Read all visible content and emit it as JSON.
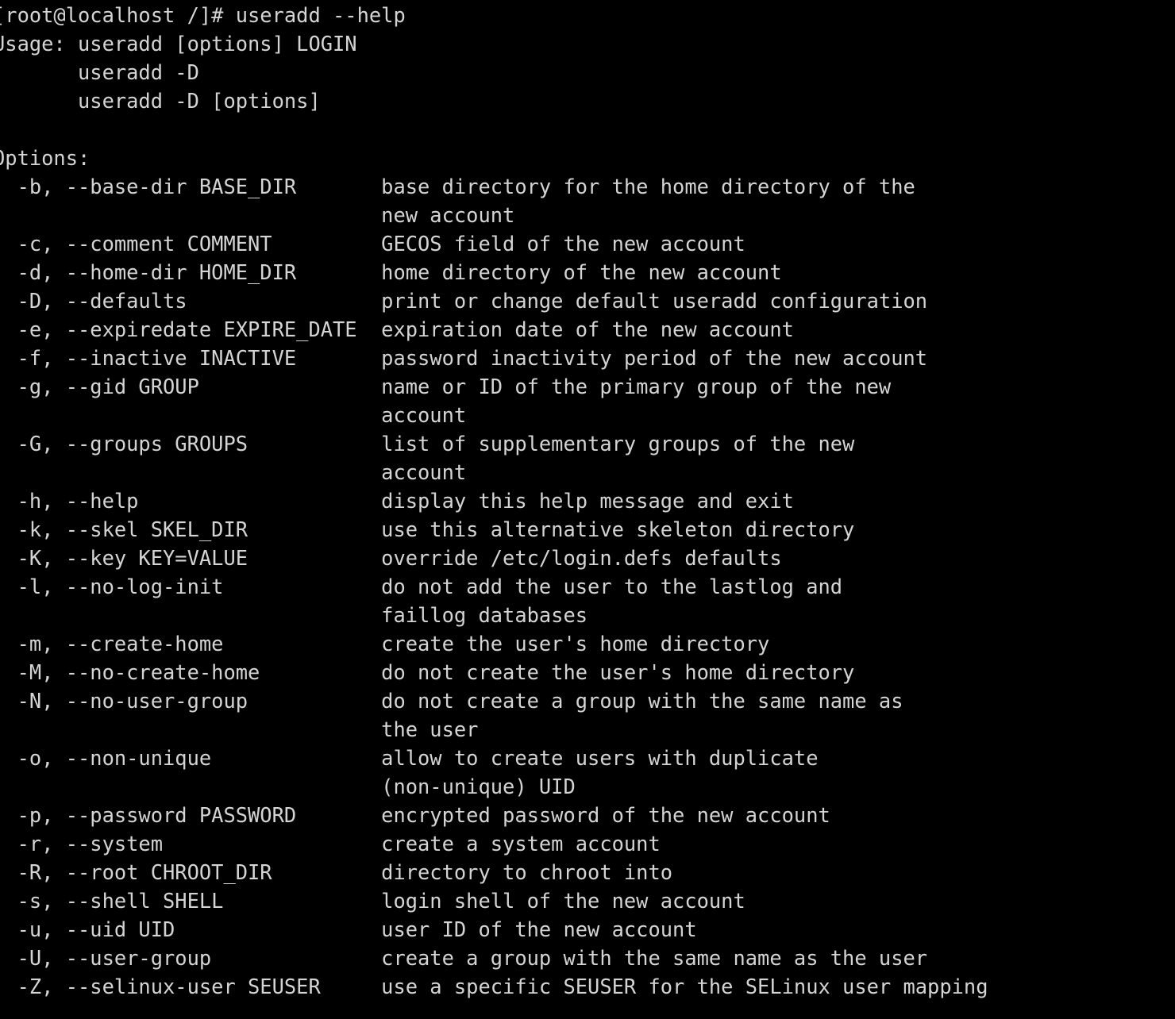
{
  "terminal": {
    "background_color": "#000000",
    "text_color": "#d4d4d4",
    "columns": 83,
    "rows": 36
  },
  "prompt": {
    "line": "[root@localhost /]# useradd --help",
    "user": "root",
    "host": "localhost",
    "cwd": "/",
    "symbol": "#",
    "command": "useradd --help"
  },
  "usage": {
    "lines": [
      "Usage: useradd [options] LOGIN",
      "       useradd -D",
      "       useradd -D [options]"
    ]
  },
  "options_heading": "Options:",
  "option_column_width": 32,
  "options": [
    {
      "flags": "  -b, --base-dir BASE_DIR",
      "description": [
        "base directory for the home directory of the",
        "new account"
      ]
    },
    {
      "flags": "  -c, --comment COMMENT",
      "description": [
        "GECOS field of the new account"
      ]
    },
    {
      "flags": "  -d, --home-dir HOME_DIR",
      "description": [
        "home directory of the new account"
      ]
    },
    {
      "flags": "  -D, --defaults",
      "description": [
        "print or change default useradd configuration"
      ]
    },
    {
      "flags": "  -e, --expiredate EXPIRE_DATE",
      "description": [
        "expiration date of the new account"
      ]
    },
    {
      "flags": "  -f, --inactive INACTIVE",
      "description": [
        "password inactivity period of the new account"
      ]
    },
    {
      "flags": "  -g, --gid GROUP",
      "description": [
        "name or ID of the primary group of the new",
        "account"
      ]
    },
    {
      "flags": "  -G, --groups GROUPS",
      "description": [
        "list of supplementary groups of the new",
        "account"
      ]
    },
    {
      "flags": "  -h, --help",
      "description": [
        "display this help message and exit"
      ]
    },
    {
      "flags": "  -k, --skel SKEL_DIR",
      "description": [
        "use this alternative skeleton directory"
      ]
    },
    {
      "flags": "  -K, --key KEY=VALUE",
      "description": [
        "override /etc/login.defs defaults"
      ]
    },
    {
      "flags": "  -l, --no-log-init",
      "description": [
        "do not add the user to the lastlog and",
        "faillog databases"
      ]
    },
    {
      "flags": "  -m, --create-home",
      "description": [
        "create the user's home directory"
      ]
    },
    {
      "flags": "  -M, --no-create-home",
      "description": [
        "do not create the user's home directory"
      ]
    },
    {
      "flags": "  -N, --no-user-group",
      "description": [
        "do not create a group with the same name as",
        "the user"
      ]
    },
    {
      "flags": "  -o, --non-unique",
      "description": [
        "allow to create users with duplicate",
        "(non-unique) UID"
      ]
    },
    {
      "flags": "  -p, --password PASSWORD",
      "description": [
        "encrypted password of the new account"
      ]
    },
    {
      "flags": "  -r, --system",
      "description": [
        "create a system account"
      ]
    },
    {
      "flags": "  -R, --root CHROOT_DIR",
      "description": [
        "directory to chroot into"
      ]
    },
    {
      "flags": "  -s, --shell SHELL",
      "description": [
        "login shell of the new account"
      ]
    },
    {
      "flags": "  -u, --uid UID",
      "description": [
        "user ID of the new account"
      ]
    },
    {
      "flags": "  -U, --user-group",
      "description": [
        "create a group with the same name as the user"
      ]
    },
    {
      "flags": "  -Z, --selinux-user SEUSER",
      "description": [
        "use a specific SEUSER for the SELinux user mapping"
      ]
    }
  ]
}
